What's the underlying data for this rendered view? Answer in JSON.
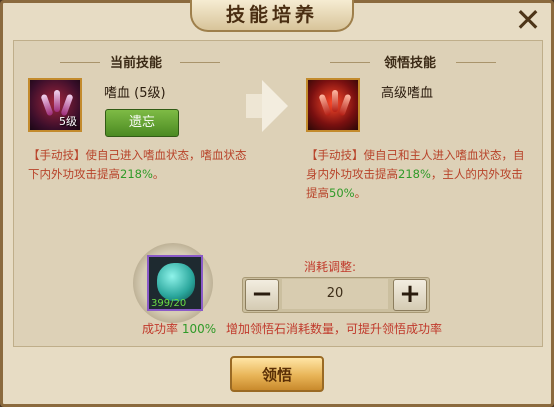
{
  "window": {
    "title": "技能培养",
    "close_icon": "close-icon"
  },
  "current_skill": {
    "section_title": "当前技能",
    "name": "嗜血 (5级)",
    "level_badge": "5级",
    "forget_button": "遗忘",
    "desc_prefix": "【手动技】使自己进入嗜血状态，嗜血状态下内外功攻击提高",
    "desc_value": "218%",
    "desc_suffix": "。"
  },
  "learn_skill": {
    "section_title": "领悟技能",
    "name": "高级嗜血",
    "desc_prefix": "【手动技】使自己和主人进入嗜血状态，自身内外功攻击提高",
    "desc_value1": "218%",
    "desc_mid": "，主人的内外攻击提高",
    "desc_value2": "50%",
    "desc_suffix": "。"
  },
  "material": {
    "count": "399/20",
    "rate_label": "成功率",
    "rate_value": "100%"
  },
  "adjust": {
    "label": "消耗调整:",
    "minus": "−",
    "plus": "+",
    "value": "20",
    "hint": "增加领悟石消耗数量，可提升领悟成功率"
  },
  "confirm_button": "领悟"
}
